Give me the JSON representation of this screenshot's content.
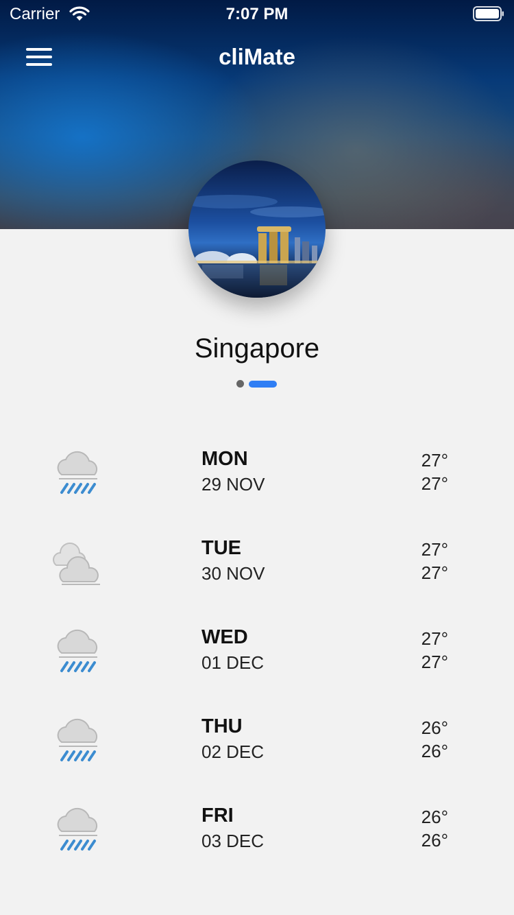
{
  "status_bar": {
    "carrier": "Carrier",
    "time": "7:07 PM"
  },
  "nav": {
    "title": "cliMate"
  },
  "location": {
    "city": "Singapore"
  },
  "pager": {
    "pages": 2,
    "current": 2
  },
  "colors": {
    "accent": "#2f7ef4",
    "background": "#f2f2f2"
  },
  "forecast": [
    {
      "icon": "rain-cloud-icon",
      "day": "MON",
      "date": "29 NOV",
      "high": "27°",
      "low": "27°"
    },
    {
      "icon": "cloudy-icon",
      "day": "TUE",
      "date": "30 NOV",
      "high": "27°",
      "low": "27°"
    },
    {
      "icon": "rain-cloud-icon",
      "day": "WED",
      "date": "01 DEC",
      "high": "27°",
      "low": "27°"
    },
    {
      "icon": "rain-cloud-icon",
      "day": "THU",
      "date": "02 DEC",
      "high": "26°",
      "low": "26°"
    },
    {
      "icon": "rain-cloud-icon",
      "day": "FRI",
      "date": "03 DEC",
      "high": "26°",
      "low": "26°"
    }
  ]
}
